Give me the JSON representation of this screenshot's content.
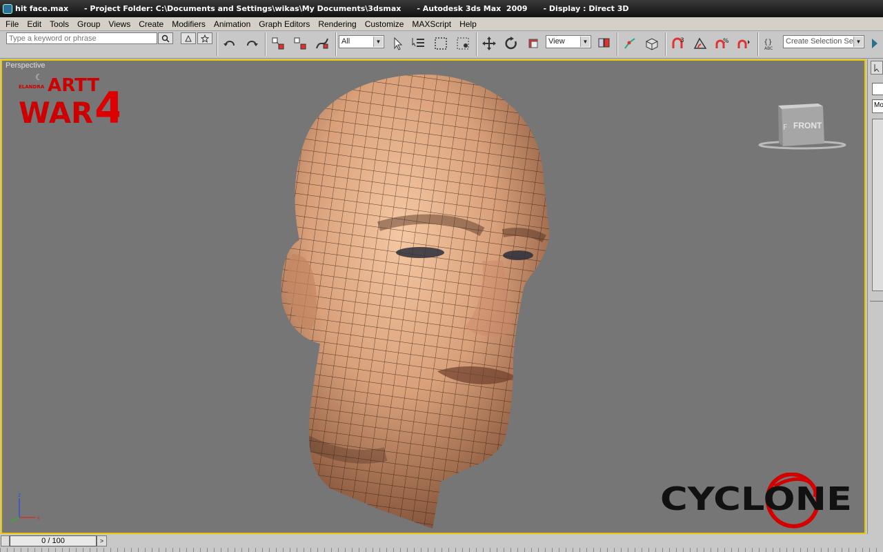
{
  "window": {
    "title": "hit face.max      - Project Folder: C:\\Documents and Settings\\wikas\\My Documents\\3dsmax      - Autodesk 3ds Max  2009      - Display : Direct 3D"
  },
  "menu": [
    "File",
    "Edit",
    "Tools",
    "Group",
    "Views",
    "Create",
    "Modifiers",
    "Animation",
    "Graph Editors",
    "Rendering",
    "Customize",
    "MAXScript",
    "Help"
  ],
  "search": {
    "placeholder": "Type a keyword or phrase"
  },
  "toolbar": {
    "selection_filter": "All",
    "reference_coord": "View",
    "named_selection_placeholder": "Create Selection Set"
  },
  "viewport": {
    "label": "Perspective",
    "viewcube_face": "FRONT",
    "axis": {
      "x": "x",
      "y": "y",
      "z": "z"
    },
    "overlay_logo_artt": "ARTT WAR4",
    "overlay_logo_cyclone": "CYCLONE",
    "border_color": "#e8c800",
    "background": "#767676"
  },
  "timeline": {
    "frame": "0 / 100"
  },
  "right_panel": {
    "label_fragment": "Mo"
  }
}
